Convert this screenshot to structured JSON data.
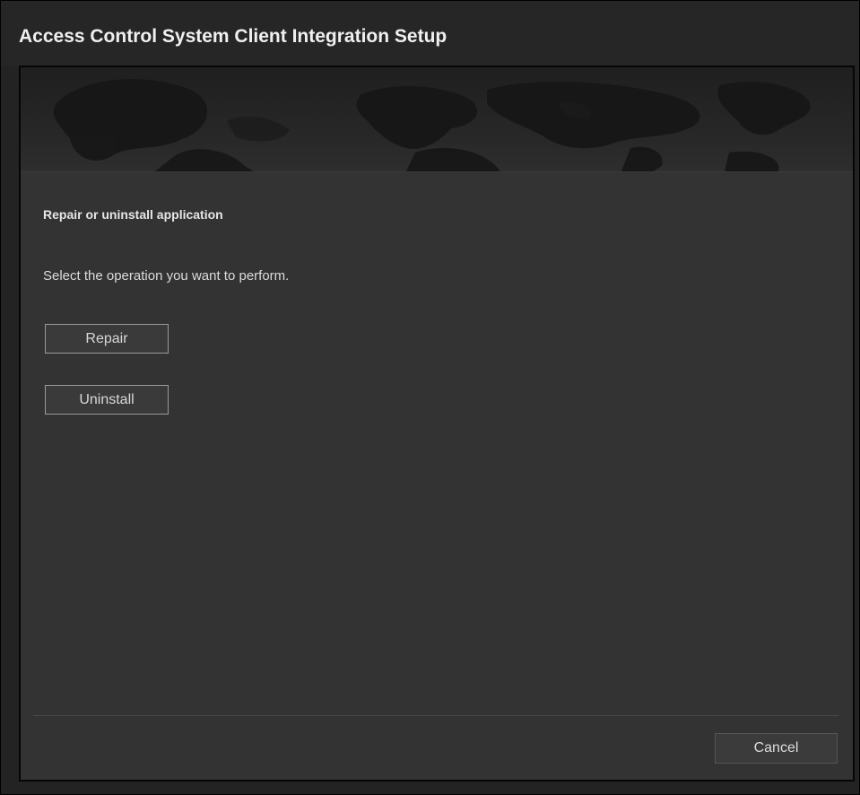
{
  "window": {
    "title": "Access Control System Client Integration Setup"
  },
  "page": {
    "heading": "Repair or uninstall application",
    "instruction": "Select the operation you want to perform."
  },
  "actions": {
    "repair_label": "Repair",
    "uninstall_label": "Uninstall"
  },
  "footer": {
    "cancel_label": "Cancel"
  },
  "banner": {
    "icon": "world-map-background"
  }
}
